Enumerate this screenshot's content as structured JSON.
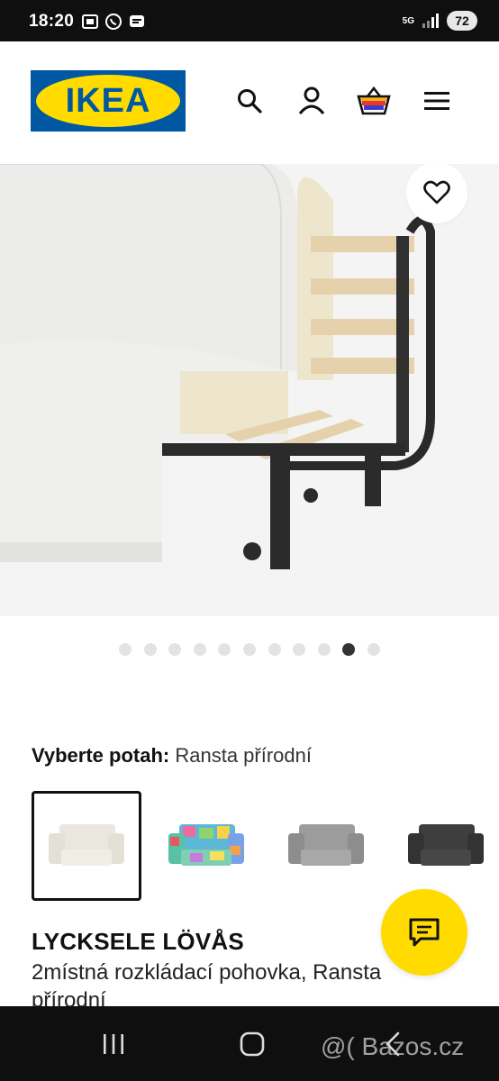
{
  "status_bar": {
    "time": "18:20",
    "network": "5G",
    "battery": "72",
    "icons_left": [
      "screenshot-icon",
      "whatsapp-icon",
      "message-icon"
    ],
    "icons_right": [
      "network-5g-icon",
      "signal-icon",
      "battery-icon"
    ]
  },
  "header": {
    "logo_text": "IKEA",
    "icons": [
      "search-icon",
      "user-icon",
      "basket-icon",
      "menu-icon"
    ]
  },
  "gallery": {
    "total_images": 11,
    "active_index": 9,
    "favorite_icon": "heart-icon"
  },
  "cover": {
    "label": "Vyberte potah:",
    "value": "Ransta přírodní",
    "swatches": [
      {
        "name": "ransta-natural",
        "color": "#e9e6de",
        "selected": true
      },
      {
        "name": "multicolor-patchwork",
        "color": "#7cc7a8",
        "selected": false
      },
      {
        "name": "grey",
        "color": "#9a9a9a",
        "selected": false
      },
      {
        "name": "dark-grey",
        "color": "#3c3c3c",
        "selected": false
      }
    ]
  },
  "product": {
    "name": "LYCKSELE LÖVÅS",
    "description": "2místná rozkládací pohovka, Ransta přírodní"
  },
  "chat": {
    "icon": "chat-icon",
    "color": "#ffdb00"
  },
  "nav_bar": {
    "buttons": [
      "recents-icon",
      "home-icon",
      "back-icon"
    ]
  },
  "watermark": "@( Bazos.cz",
  "colors": {
    "ikea_blue": "#0058a3",
    "ikea_yellow": "#ffdb00"
  }
}
